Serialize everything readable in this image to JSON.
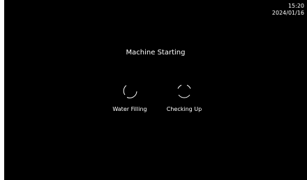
{
  "status_bar": {
    "time": "15:20",
    "date": "2024/01/16"
  },
  "main": {
    "title": "Machine Starting",
    "steps": [
      {
        "label": "Water Filling",
        "icon": "spinner-icon"
      },
      {
        "label": "Checking Up",
        "icon": "spinner-icon"
      }
    ]
  },
  "colors": {
    "background": "#000000",
    "text": "#ffffff"
  }
}
